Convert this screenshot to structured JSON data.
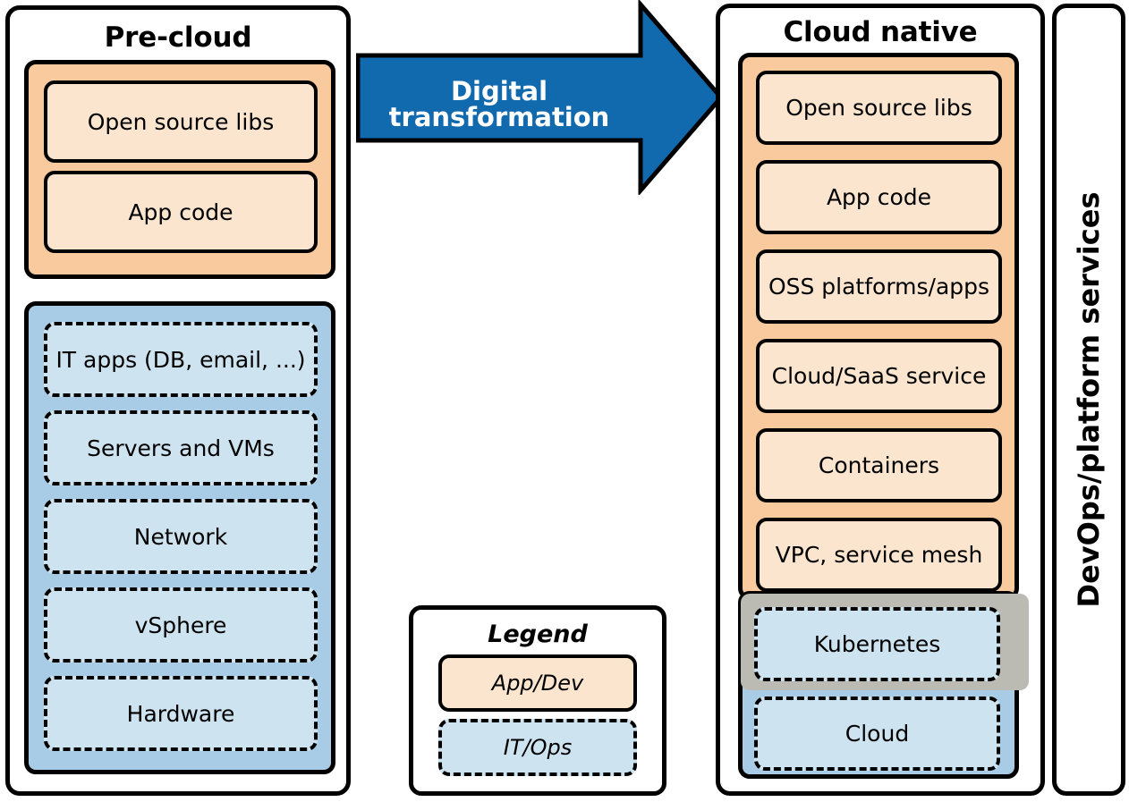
{
  "diagram": {
    "title_left": "Pre-cloud",
    "title_right": "Cloud native",
    "arrow_label": "Digital transformation",
    "vertical_panel_label": "DevOps/platform  services",
    "colors": {
      "app_group": "#f8ca9d",
      "app_item": "#fbe5ce",
      "ops_group": "#a8cce5",
      "ops_item": "#cee3f0",
      "k8s_band": "#bbbbb3",
      "arrow": "#1169ae",
      "stroke": "#000000",
      "arrow_text": "#ffffff"
    }
  },
  "precloud": {
    "title": "Pre-cloud",
    "app_group": {
      "kind": "App/Dev",
      "items": [
        {
          "label": "Open source libs"
        },
        {
          "label": "App code"
        }
      ]
    },
    "ops_group": {
      "kind": "IT/Ops",
      "items": [
        {
          "label": "IT apps (DB, email, ...)"
        },
        {
          "label": "Servers and VMs"
        },
        {
          "label": "Network"
        },
        {
          "label": "vSphere"
        },
        {
          "label": "Hardware"
        }
      ]
    }
  },
  "cloudnative": {
    "title": "Cloud native",
    "app_group": {
      "kind": "App/Dev",
      "items": [
        {
          "label": "Open source libs"
        },
        {
          "label": "App code"
        },
        {
          "label": "OSS platforms/apps"
        },
        {
          "label": "Cloud/SaaS service"
        },
        {
          "label": "Containers"
        },
        {
          "label": "VPC, service mesh"
        }
      ]
    },
    "k8s_band": {
      "label": "Kubernetes"
    },
    "cloud_band": {
      "label": "Cloud"
    }
  },
  "legend": {
    "title": "Legend",
    "items": [
      {
        "label": "App/Dev",
        "kind": "solid"
      },
      {
        "label": "IT/Ops",
        "kind": "dashed"
      }
    ]
  }
}
